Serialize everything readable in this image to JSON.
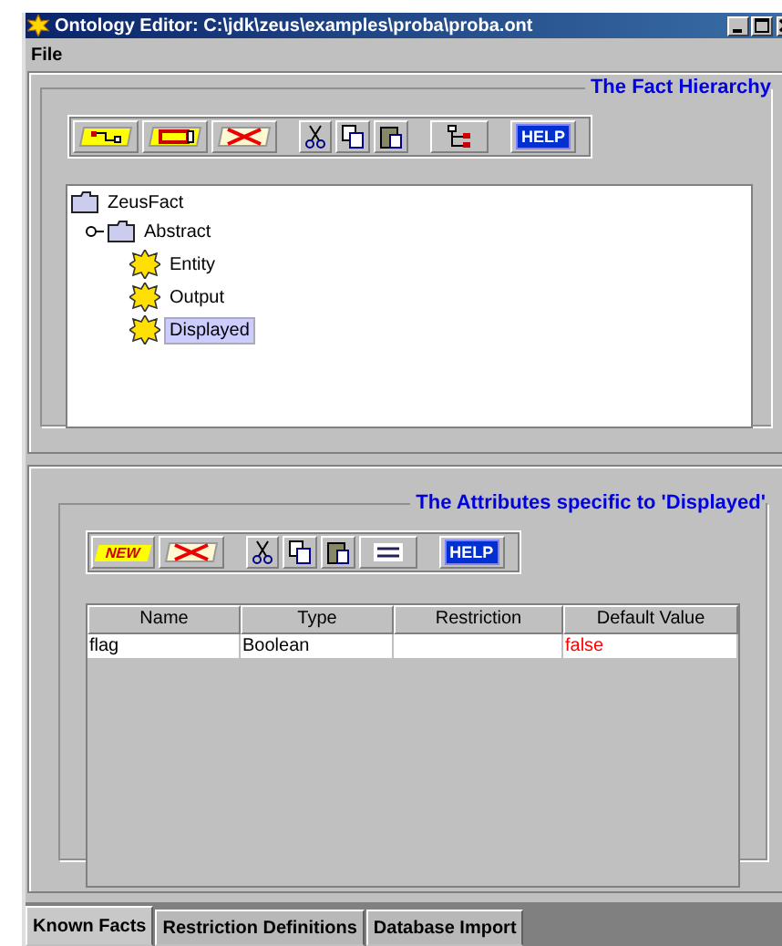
{
  "window": {
    "title": "Ontology Editor: C:\\jdk\\zeus\\examples\\proba\\proba.ont"
  },
  "menu": [
    "File"
  ],
  "fact_hierarchy": {
    "title": "The Fact Hierarchy",
    "toolbar": [
      {
        "kind": "add_child"
      },
      {
        "kind": "add_sibling"
      },
      {
        "kind": "delete"
      },
      {
        "kind": "sep"
      },
      {
        "kind": "cut"
      },
      {
        "kind": "copy"
      },
      {
        "kind": "paste"
      },
      {
        "kind": "sep"
      },
      {
        "kind": "hierarchy"
      },
      {
        "kind": "sep"
      },
      {
        "kind": "help",
        "label": "HELP"
      }
    ],
    "tree": {
      "label": "ZeusFact",
      "kind": "folder",
      "selected": false,
      "children": [
        {
          "label": "Abstract",
          "kind": "folder",
          "selected": false,
          "expanded": true,
          "children": [
            {
              "label": "Entity",
              "kind": "fact",
              "selected": false
            },
            {
              "label": "Output",
              "kind": "fact",
              "selected": false
            },
            {
              "label": "Displayed",
              "kind": "fact",
              "selected": true
            }
          ]
        }
      ]
    }
  },
  "attributes": {
    "title": "The Attributes specific to 'Displayed'",
    "toolbar": [
      {
        "kind": "new",
        "label": "NEW"
      },
      {
        "kind": "delete"
      },
      {
        "kind": "sep"
      },
      {
        "kind": "cut"
      },
      {
        "kind": "copy"
      },
      {
        "kind": "paste"
      },
      {
        "kind": "rows"
      },
      {
        "kind": "sep"
      },
      {
        "kind": "help",
        "label": "HELP"
      }
    ],
    "table": {
      "columns": [
        "Name",
        "Type",
        "Restriction",
        "Default Value"
      ],
      "rows": [
        {
          "name": "flag",
          "type": "Boolean",
          "default_value": "false"
        }
      ]
    }
  },
  "tabs": [
    {
      "label": "Known Facts",
      "selected": true
    },
    {
      "label": "Restriction Definitions",
      "selected": false
    },
    {
      "label": "Database Import",
      "selected": false
    }
  ]
}
